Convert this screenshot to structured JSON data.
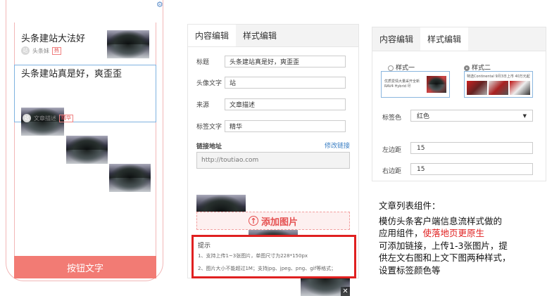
{
  "phone": {
    "article1": {
      "title": "头条建站大法好",
      "author_avatar": "站",
      "author": "头条妹",
      "badge": "热"
    },
    "article2": {
      "title": "头条建站真是好，爽歪歪",
      "author_avatar": "站",
      "source": "文章描述",
      "badge": "精华"
    },
    "bottom_button": "按钮文字",
    "settings_icon": "gear-icon"
  },
  "editor": {
    "tabs": [
      "内容编辑",
      "样式编辑"
    ],
    "fields": [
      {
        "label": "标题",
        "value": "头条建站真是好，爽歪歪"
      },
      {
        "label": "头像文字",
        "value": "站"
      },
      {
        "label": "来源",
        "value": "文章描述"
      },
      {
        "label": "标签文字",
        "value": "精华"
      }
    ],
    "link_label": "链接地址",
    "link_edit": "修改链接",
    "link_value": "http://toutiao.com",
    "remove_icon": "close-icon",
    "add_image": "添加图片",
    "tips_title": "提示",
    "tips": [
      "1、支持上传1~3张图片，单图尺寸为228*150px",
      "2、图片大小不能超过1M；支持jpg、jpeg、png、gif等格式；"
    ]
  },
  "style_editor": {
    "tabs": [
      "内容编辑",
      "样式编辑"
    ],
    "option1": "样式一",
    "option2": "样式二",
    "preview1_text": "优质爱情大量采开全新RAV4 Hybrid 尽",
    "preview2_text": "特选Continental 9月3日上市 40万元起",
    "tag_color_label": "标签色",
    "tag_color_value": "红色",
    "left_margin_label": "左边距",
    "left_margin_value": "15",
    "right_margin_label": "右边距",
    "right_margin_value": "15"
  },
  "description": {
    "title": "文章列表组件：",
    "line1": "模仿头条客户端信息流样式做的",
    "line2a": "应用组件，",
    "line2b": "使落地页更原生",
    "line3": "可添加链接，上传1-3张图片，提",
    "line4": "供左文右图和上文下图两种样式，",
    "line5": "设置标签颜色等"
  },
  "colors": {
    "accent_red": "#e02020",
    "button_red": "#f27b74",
    "select_blue": "#7fb2e0"
  }
}
